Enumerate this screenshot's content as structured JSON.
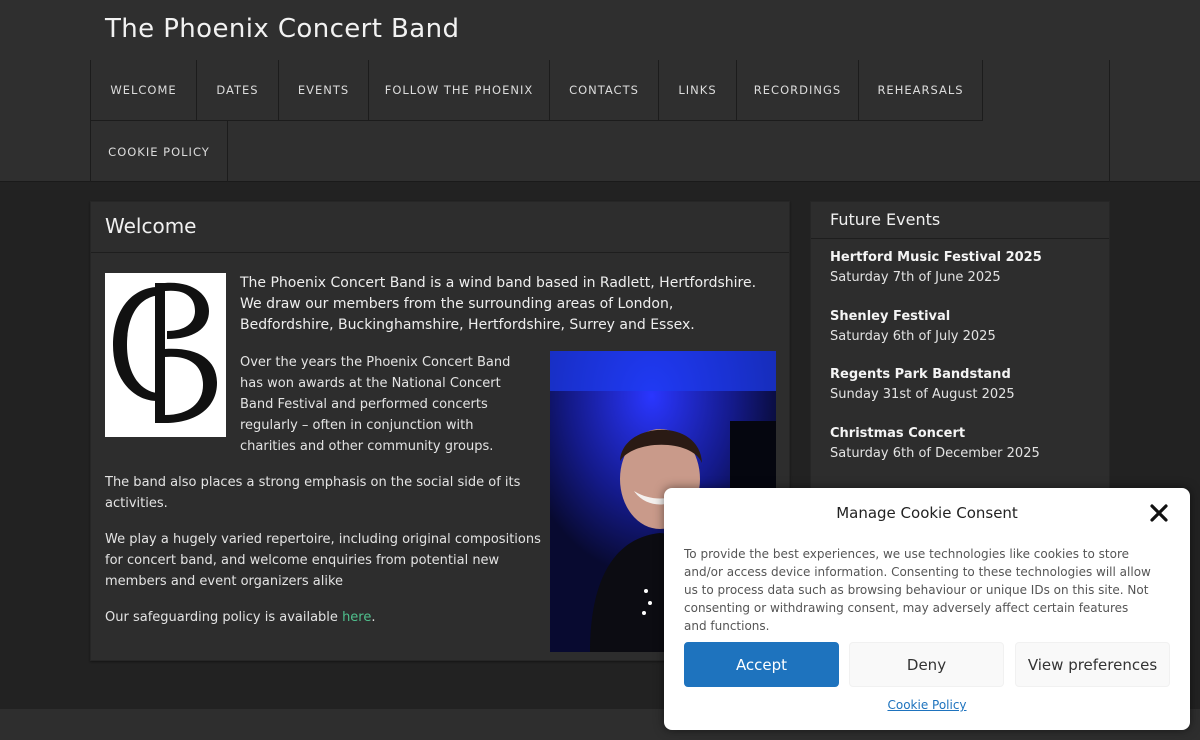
{
  "site": {
    "title": "The Phoenix Concert Band"
  },
  "nav": {
    "row1": [
      "WELCOME",
      "DATES",
      "EVENTS",
      "FOLLOW THE PHOENIX",
      "CONTACTS",
      "LINKS",
      "RECORDINGS",
      "REHEARSALS"
    ],
    "row2": [
      "COOKIE POLICY"
    ]
  },
  "content": {
    "title": "Welcome",
    "logo_text": "PCB",
    "intro": "The Phoenix Concert Band is a wind band based in Radlett, Hertfordshire.  We draw our members from the surrounding areas of London, Bedfordshire, Buckinghamshire, Hertfordshire, Surrey and Essex.",
    "p1": "Over the years the Phoenix Concert Band has won awards at the National Concert Band Festival and performed concerts regularly – often in conjunction with charities and other community groups.",
    "p2": "The band also places a strong emphasis on the social side of its activities.",
    "p3": "We play a hugely varied repertoire, including original compositions for concert band, and welcome enquiries from potential new members and event organizers alike",
    "p4_prefix": "Our safeguarding policy is available ",
    "p4_link": "here",
    "p4_suffix": "."
  },
  "sidebar": {
    "title": "Future Events",
    "events": [
      {
        "title": "Hertford Music Festival 2025",
        "date": "Saturday 7th of June 2025"
      },
      {
        "title": "Shenley Festival",
        "date": "Saturday 6th of July 2025"
      },
      {
        "title": "Regents Park Bandstand",
        "date": "Sunday 31st of August 2025"
      },
      {
        "title": "Christmas Concert",
        "date": "Saturday 6th of December 2025"
      }
    ]
  },
  "cookie": {
    "title": "Manage Cookie Consent",
    "text": "To provide the best experiences, we use technologies like cookies to store and/or access device information. Consenting to these technologies will allow us to process data such as browsing behaviour or unique IDs on this site. Not consenting or withdrawing consent, may adversely affect certain features and functions.",
    "accept": "Accept",
    "deny": "Deny",
    "preferences": "View preferences",
    "policy_link": "Cookie Policy"
  },
  "colors": {
    "accent_blue": "#1e73be",
    "link_green": "#4fc08d",
    "background": "#222222",
    "panel": "#2d2d2d"
  }
}
